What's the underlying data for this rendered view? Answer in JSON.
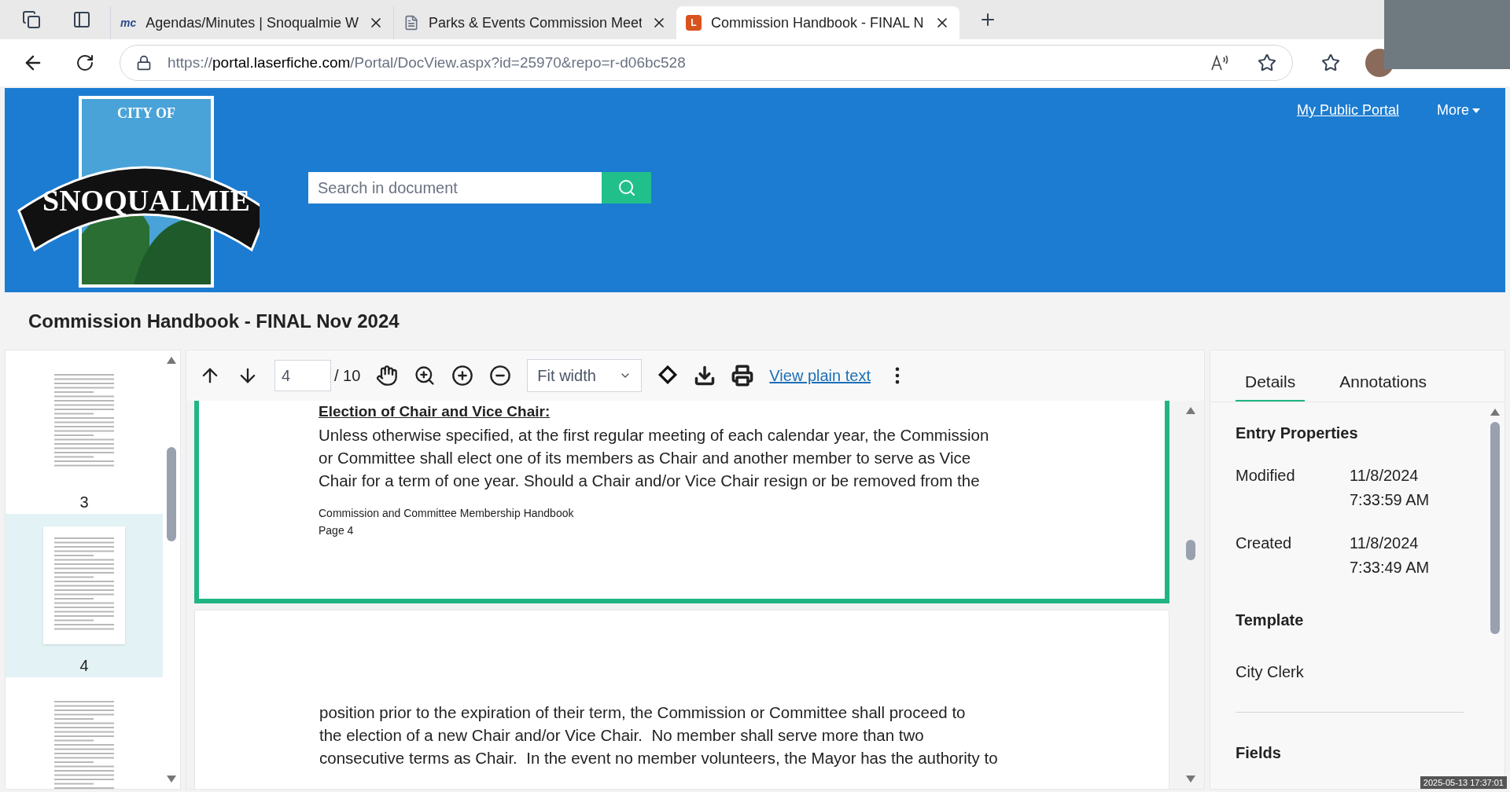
{
  "browser": {
    "tabs": [
      {
        "title": "Agendas/Minutes | Snoqualmie W",
        "icon": "mc",
        "selected": false
      },
      {
        "title": "Parks & Events Commission Meet",
        "selected": false
      },
      {
        "title": "Commission Handbook - FINAL N",
        "icon": "L",
        "selected": true
      }
    ],
    "url": {
      "scheme": "https://",
      "host": "portal.laserfiche.com",
      "path": "/Portal/DocView.aspx?id=25970&repo=r-d06bc528"
    }
  },
  "header": {
    "logo": {
      "top": "CITY OF",
      "name": "SNOQUALMIE"
    },
    "search": {
      "placeholder": "Search in document"
    },
    "links": [
      {
        "label": "My Public Portal",
        "kind": "link"
      },
      {
        "label": "More",
        "kind": "menu"
      }
    ]
  },
  "document_title": "Commission Handbook - FINAL Nov 2024",
  "thumbnails": [
    {
      "label": "3",
      "selected": false
    },
    {
      "label": "4",
      "selected": true
    },
    {
      "selected": false
    }
  ],
  "toolbar": {
    "page": "4",
    "page_count": "/ 10",
    "zoom_mode": "Fit width",
    "plain_text_link": "View plain text"
  },
  "pages": [
    {
      "selected": true,
      "heading": "Election of Chair and Vice Chair:",
      "lines": [
        "Unless otherwise specified, at the first regular meeting of each calendar year, the Commission",
        "or Committee shall elect one of its members as Chair and another member to serve as Vice",
        "Chair for a term of one year. Should a Chair and/or Vice Chair resign or be removed from the"
      ],
      "footer": [
        "Commission and Committee Membership Handbook",
        "Page 4"
      ]
    },
    {
      "selected": false,
      "lines": [
        "position prior to the expiration of their term, the Commission or Committee shall proceed to",
        "the election of a new Chair and/or Vice Chair.  No member shall serve more than two",
        "consecutive terms as Chair.  In the event no member volunteers, the Mayor has the authority to"
      ]
    }
  ],
  "details": {
    "tabs": [
      {
        "label": "Details",
        "selected": true
      },
      {
        "label": "Annotations",
        "selected": false
      }
    ],
    "sections": [
      {
        "kind": "properties",
        "title": "Entry Properties",
        "rows": [
          {
            "label": "Modified",
            "value": [
              "11/8/2024",
              "7:33:59 AM"
            ]
          },
          {
            "label": "Created",
            "value": [
              "11/8/2024",
              "7:33:49 AM"
            ]
          }
        ]
      },
      {
        "kind": "text",
        "title": "Template",
        "value": "City Clerk"
      },
      {
        "kind": "heading",
        "title": "Fields"
      }
    ]
  },
  "timestamp": "2025-05-13 17:37:01"
}
